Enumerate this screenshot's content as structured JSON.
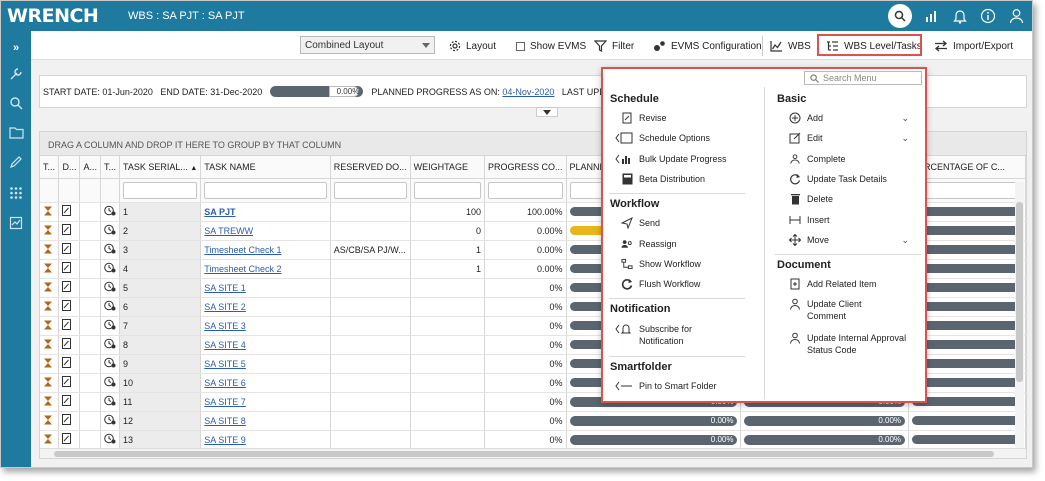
{
  "app": {
    "logo": "WRENCH",
    "wbs_title": "WBS : SA PJT : SA PJT"
  },
  "toolbar": {
    "layout_select": "Combined Layout",
    "layout": "Layout",
    "show_evms": "Show EVMS",
    "filter": "Filter",
    "evms_config": "EVMS Configuration",
    "wbs": "WBS",
    "wbs_level_tasks": "WBS Level/Tasks",
    "import_export": "Import/Export"
  },
  "info": {
    "start_label": "START DATE:",
    "start_date": "01-Jun-2020",
    "end_label": "END DATE:",
    "end_date": "31-Dec-2020",
    "progress": "0.00%",
    "planned_label": "PLANNED PROGRESS AS ON:",
    "planned_date": "04-Nov-2020",
    "last_upd": "LAST UPD"
  },
  "grid": {
    "group_hint": "DRAG A COLUMN AND DROP IT HERE TO GROUP BY THAT COLUMN",
    "columns": [
      "T...",
      "D...",
      "A...",
      "T...",
      "TASK SERIAL...",
      "TASK NAME",
      "RESERVED DO...",
      "WEIGHTAGE",
      "PROGRESS CO...",
      "PLANNED",
      "",
      "PERCENTAGE OF C..."
    ],
    "rows": [
      {
        "serial": "1",
        "name": "SA PJT",
        "bold": true,
        "reserved": "",
        "weight": "100",
        "progress": "100.00%",
        "bar": "gray"
      },
      {
        "serial": "2",
        "name": "SA TREWW",
        "reserved": "",
        "weight": "0",
        "progress": "0.00%",
        "bar": "yellow"
      },
      {
        "serial": "3",
        "name": "Timesheet Check 1",
        "reserved": "AS/CB/SA PJ/W...",
        "weight": "1",
        "progress": "0.00%",
        "bar": "gray"
      },
      {
        "serial": "4",
        "name": "Timesheet Check 2",
        "reserved": "",
        "weight": "1",
        "progress": "0.00%",
        "bar": "gray"
      },
      {
        "serial": "5",
        "name": "SA SITE 1",
        "reserved": "",
        "weight": "",
        "progress": "0%",
        "bar": "gray"
      },
      {
        "serial": "6",
        "name": "SA SITE 2",
        "reserved": "",
        "weight": "",
        "progress": "0%",
        "bar": "gray"
      },
      {
        "serial": "7",
        "name": "SA SITE 3",
        "reserved": "",
        "weight": "",
        "progress": "0%",
        "bar": "gray"
      },
      {
        "serial": "8",
        "name": "SA SITE 4",
        "reserved": "",
        "weight": "",
        "progress": "0%",
        "bar": "gray"
      },
      {
        "serial": "9",
        "name": "SA SITE 5",
        "reserved": "",
        "weight": "",
        "progress": "0%",
        "bar": "gray"
      },
      {
        "serial": "10",
        "name": "SA SITE 6",
        "reserved": "",
        "weight": "",
        "progress": "0%",
        "bar": "gray"
      },
      {
        "serial": "11",
        "name": "SA SITE 7",
        "reserved": "",
        "weight": "",
        "progress": "0%",
        "bar": "done",
        "bar_label": "0.00%",
        "bar2_label": "0.00%"
      },
      {
        "serial": "12",
        "name": "SA SITE 8",
        "reserved": "",
        "weight": "",
        "progress": "0%",
        "bar": "done",
        "bar_label": "0.00%",
        "bar2_label": "0.00%"
      },
      {
        "serial": "13",
        "name": "SA SITE 9",
        "reserved": "",
        "weight": "",
        "progress": "0%",
        "bar": "done",
        "bar_label": "0.00%",
        "bar2_label": "0.00%"
      }
    ]
  },
  "menu": {
    "search_placeholder": "Search Menu",
    "schedule": {
      "title": "Schedule",
      "items": [
        "Revise",
        "Schedule Options",
        "Bulk Update Progress",
        "Beta Distribution"
      ]
    },
    "workflow": {
      "title": "Workflow",
      "items": [
        "Send",
        "Reassign",
        "Show Workflow",
        "Flush Workflow"
      ]
    },
    "notification": {
      "title": "Notification",
      "items": [
        "Subscribe for Notification"
      ]
    },
    "smartfolder": {
      "title": "Smartfolder",
      "items": [
        "Pin to Smart Folder"
      ]
    },
    "basic": {
      "title": "Basic",
      "items": [
        "Add",
        "Edit",
        "Complete",
        "Update Task Details",
        "Delete",
        "Insert",
        "Move"
      ]
    },
    "document": {
      "title": "Document",
      "items": [
        "Add Related Item",
        "Update Client Comment",
        "Update Internal Approval Status Code"
      ]
    }
  },
  "colors": {
    "topbar": "#1f7aa0",
    "highlight": "#d9534f",
    "bar": "#5b6570",
    "bar_yellow": "#e8b51a"
  }
}
